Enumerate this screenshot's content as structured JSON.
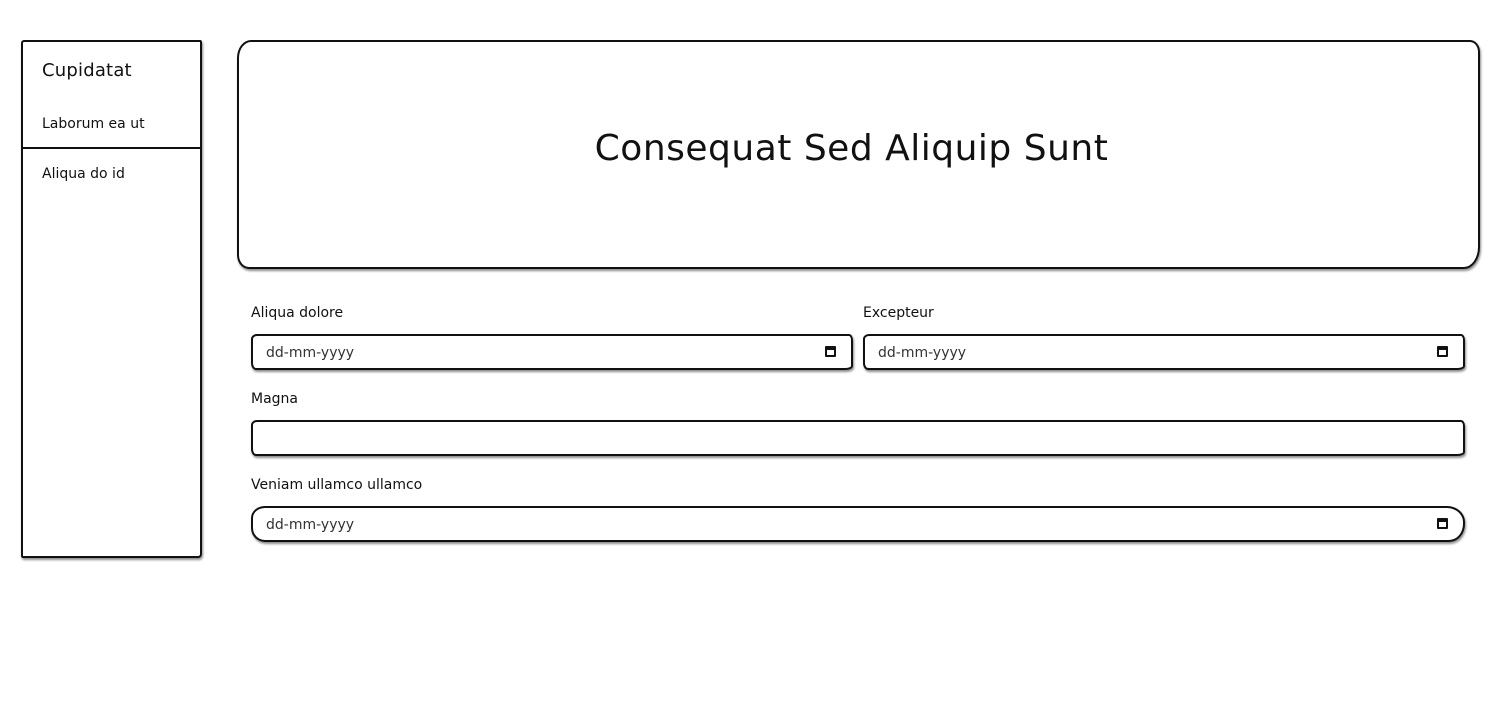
{
  "sidebar": {
    "title": "Cupidatat",
    "items": [
      {
        "label": "Laborum ea ut"
      },
      {
        "label": "Aliqua do id"
      }
    ]
  },
  "banner": {
    "title": "Consequat Sed Aliquip Sunt"
  },
  "form": {
    "fields": [
      {
        "label": "Aliqua dolore",
        "placeholder": "dd-mm-yyyy",
        "type": "date"
      },
      {
        "label": "Excepteur",
        "placeholder": "dd-mm-yyyy",
        "type": "date"
      },
      {
        "label": "Magna",
        "value": "",
        "type": "text"
      },
      {
        "label": "Veniam ullamco ullamco",
        "placeholder": "dd-mm-yyyy",
        "type": "date"
      }
    ]
  },
  "icons": {
    "calendar": "calendar-icon"
  }
}
